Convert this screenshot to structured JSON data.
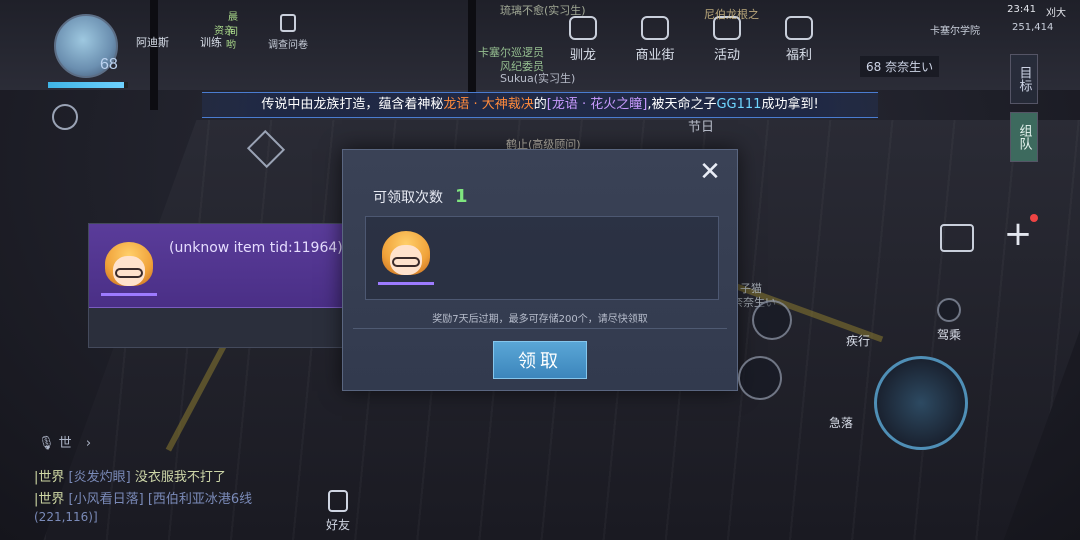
{
  "status": {
    "time": "23:41",
    "location": "卡塞尔学院",
    "coords": "251,414",
    "top_corner": "刈大"
  },
  "player": {
    "level": "68",
    "hp_fraction": 0.95,
    "mini_chat": [
      "晨间",
      "资亲",
      "哟"
    ],
    "mini_buttons": [
      "阿迪斯",
      "训练"
    ]
  },
  "top_menu": {
    "survey": "调查问卷",
    "items": [
      {
        "label": "驯龙",
        "icon": "dragon-icon"
      },
      {
        "label": "商业街",
        "icon": "cart-icon"
      },
      {
        "label": "活动",
        "icon": "parachute-icon"
      },
      {
        "label": "福利",
        "icon": "gift-icon"
      }
    ]
  },
  "world_labels": {
    "a": "琉璃不愈(实习生)",
    "b": "卡塞尔巡逻员",
    "c": "风纪委员",
    "d": "Sukua(实习生)",
    "e": "尼伯龙根之",
    "f": "节日",
    "g": "鹤止(高级顾问)",
    "h": "子猫",
    "i": "奈奈生い"
  },
  "team": {
    "count": "68",
    "name": "奈奈生い"
  },
  "right_tabs": [
    "目标",
    "组队"
  ],
  "banner": {
    "part1": "传说中由龙族打造，蕴含着神秘",
    "part2": "龙语 · 大神裁决",
    "part3": "的",
    "part4": "[龙语 · 花火之瞳]",
    "part5": ",被天命之子",
    "part6": "GG111",
    "part7": "成功拿到!"
  },
  "dialog": {
    "count_label": "可领取次数",
    "count_value": "1",
    "close_symbol": "✕",
    "note": "奖励7天后过期，最多可存储200个，请尽快领取",
    "claim_label": "领取"
  },
  "tooltip": {
    "item_name": "(unknow item tid:11964)"
  },
  "actions": {
    "sprint": "疾行",
    "drive": "驾乘",
    "dodge": "急落"
  },
  "chat": {
    "voice_label": "世",
    "lines": [
      {
        "channel": "|世界",
        "user": "[炎发灼眼]",
        "msg": "没衣服我不打了"
      },
      {
        "channel": "|世界",
        "user": "[小风看日落]",
        "msg": "[西伯利亚冰港6线"
      }
    ],
    "coord": "(221,116)]"
  },
  "friend_label": "好友",
  "colors": {
    "banner_orange": "#ff8a3c",
    "banner_purple": "#c89bff",
    "banner_cyan": "#6fd6ff",
    "count_green": "#7fe57f",
    "claim_blue": "#3c86bc",
    "tooltip_purple": "#4a2f86"
  }
}
